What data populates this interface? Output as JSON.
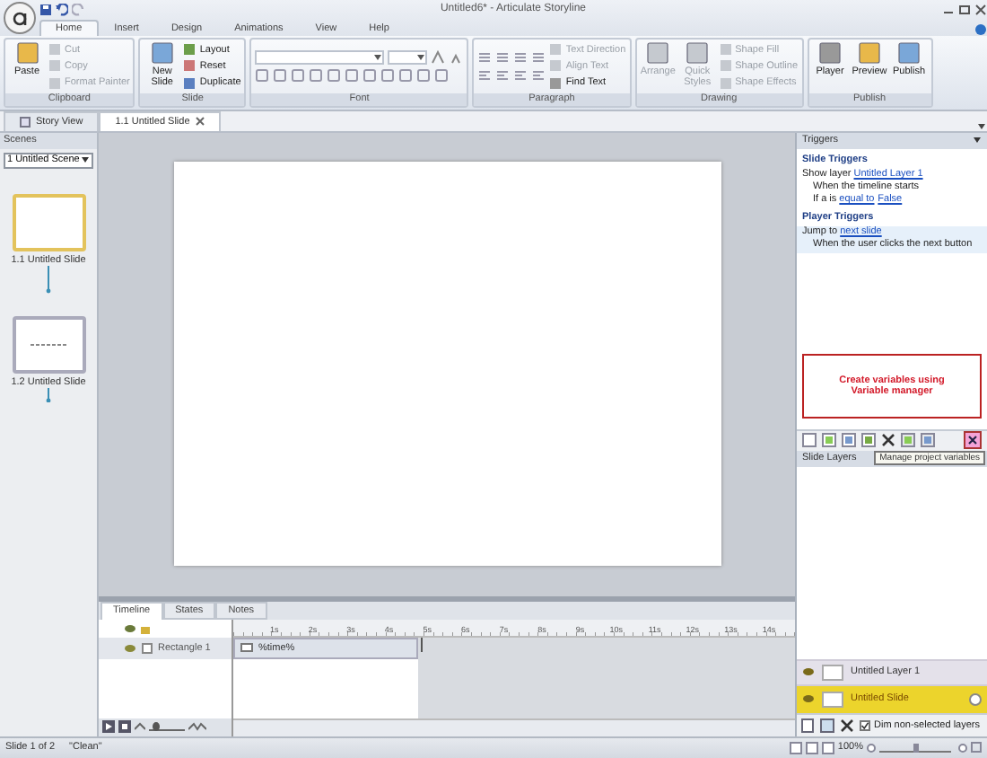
{
  "window": {
    "title": "Untitled6* - Articulate Storyline"
  },
  "ribbon_tabs": [
    {
      "label": "Home",
      "selected": true
    },
    {
      "label": "Insert",
      "selected": false
    },
    {
      "label": "Design",
      "selected": false
    },
    {
      "label": "Animations",
      "selected": false
    },
    {
      "label": "View",
      "selected": false
    },
    {
      "label": "Help",
      "selected": false
    }
  ],
  "ribbon_groups": [
    {
      "label": "Clipboard",
      "kind": "plain",
      "items": [
        {
          "label": "Paste",
          "kind": "large",
          "disabled": false
        },
        {
          "label": "Cut",
          "kind": "small",
          "disabled": true
        },
        {
          "label": "Copy",
          "kind": "small",
          "disabled": true
        },
        {
          "label": "Format Painter",
          "kind": "small",
          "disabled": true
        }
      ]
    },
    {
      "label": "Slide",
      "kind": "plain",
      "items": [
        {
          "label": "New Slide",
          "kind": "large",
          "disabled": false
        },
        {
          "label": "Layout",
          "kind": "small",
          "disabled": false
        },
        {
          "label": "Reset",
          "kind": "small",
          "disabled": false
        },
        {
          "label": "Duplicate",
          "kind": "small",
          "disabled": false
        }
      ]
    },
    {
      "label": "Font",
      "kind": "font"
    },
    {
      "label": "Paragraph",
      "kind": "paragraph",
      "items": [
        {
          "label": "Text Direction",
          "kind": "small",
          "disabled": true
        },
        {
          "label": "Align Text",
          "kind": "small",
          "disabled": true
        },
        {
          "label": "Find Text",
          "kind": "small",
          "disabled": false
        }
      ]
    },
    {
      "label": "Drawing",
      "kind": "plain",
      "items": [
        {
          "label": "Arrange",
          "kind": "large",
          "disabled": true
        },
        {
          "label": "Quick Styles",
          "kind": "large",
          "disabled": true
        },
        {
          "label": "Shape Fill",
          "kind": "small",
          "disabled": true
        },
        {
          "label": "Shape Outline",
          "kind": "small",
          "disabled": true
        },
        {
          "label": "Shape Effects",
          "kind": "small",
          "disabled": true
        }
      ]
    },
    {
      "label": "Publish",
      "kind": "plain",
      "items": [
        {
          "label": "Player",
          "kind": "large",
          "disabled": false
        },
        {
          "label": "Preview",
          "kind": "large",
          "disabled": false
        },
        {
          "label": "Publish",
          "kind": "large",
          "disabled": false
        }
      ]
    }
  ],
  "document_tabs": [
    {
      "label": "Story View",
      "selected": false
    },
    {
      "label": "1.1 Untitled Slide",
      "selected": true
    }
  ],
  "scenes": {
    "title": "Scenes",
    "scene_select": "1 Untitled Scene",
    "slides": [
      {
        "label": "1.1 Untitled Slide",
        "selected": true
      },
      {
        "label": "1.2 Untitled Slide",
        "selected": false
      }
    ]
  },
  "timeline": {
    "tabs": [
      {
        "label": "Timeline",
        "selected": true
      },
      {
        "label": "States",
        "selected": false
      },
      {
        "label": "Notes",
        "selected": false
      }
    ],
    "ruler": [
      "1s",
      "2s",
      "3s",
      "4s",
      "5s",
      "6s",
      "7s",
      "8s",
      "9s",
      "10s",
      "11s",
      "12s",
      "13s",
      "14s"
    ],
    "rows": [
      {
        "name": "Rectangle 1",
        "bar_label": "%time%"
      }
    ],
    "zoom_slider": {
      "level": 0.2
    }
  },
  "triggers": {
    "title": "Triggers",
    "sections": [
      {
        "heading": "Slide Triggers",
        "triggers": [
          {
            "selected": false,
            "action": [
              {
                "kind": "text",
                "text": "Show layer "
              },
              {
                "kind": "link",
                "text": "Untitled Layer 1"
              }
            ],
            "conditions": [
              [
                {
                  "kind": "text",
                  "text": "When the timeline starts"
                }
              ],
              [
                {
                  "kind": "text",
                  "text": "If a is "
                },
                {
                  "kind": "link",
                  "text": "equal to"
                },
                {
                  "kind": "link",
                  "text": "False"
                }
              ]
            ]
          }
        ]
      },
      {
        "heading": "Player Triggers",
        "triggers": [
          {
            "selected": true,
            "action": [
              {
                "kind": "text",
                "text": "Jump to "
              },
              {
                "kind": "link",
                "text": "next slide"
              }
            ],
            "conditions": [
              [
                {
                  "kind": "text",
                  "text": "When the user clicks the next button"
                }
              ]
            ]
          }
        ]
      }
    ]
  },
  "annotation": "Create variables using Variable manager",
  "tooltip": "Manage project variables",
  "layers": {
    "title": "Slide Layers",
    "items": [
      {
        "label": "Untitled Layer 1",
        "selected": false
      },
      {
        "label": "Untitled Slide",
        "selected": true
      }
    ],
    "dim_non_selected": {
      "label": "Dim non-selected layers",
      "checked": true
    }
  },
  "status_bar": {
    "slide": "Slide 1 of 2",
    "theme": "\"Clean\"",
    "zoom": "100%",
    "zoom_slider": {
      "level": 0.5
    }
  }
}
